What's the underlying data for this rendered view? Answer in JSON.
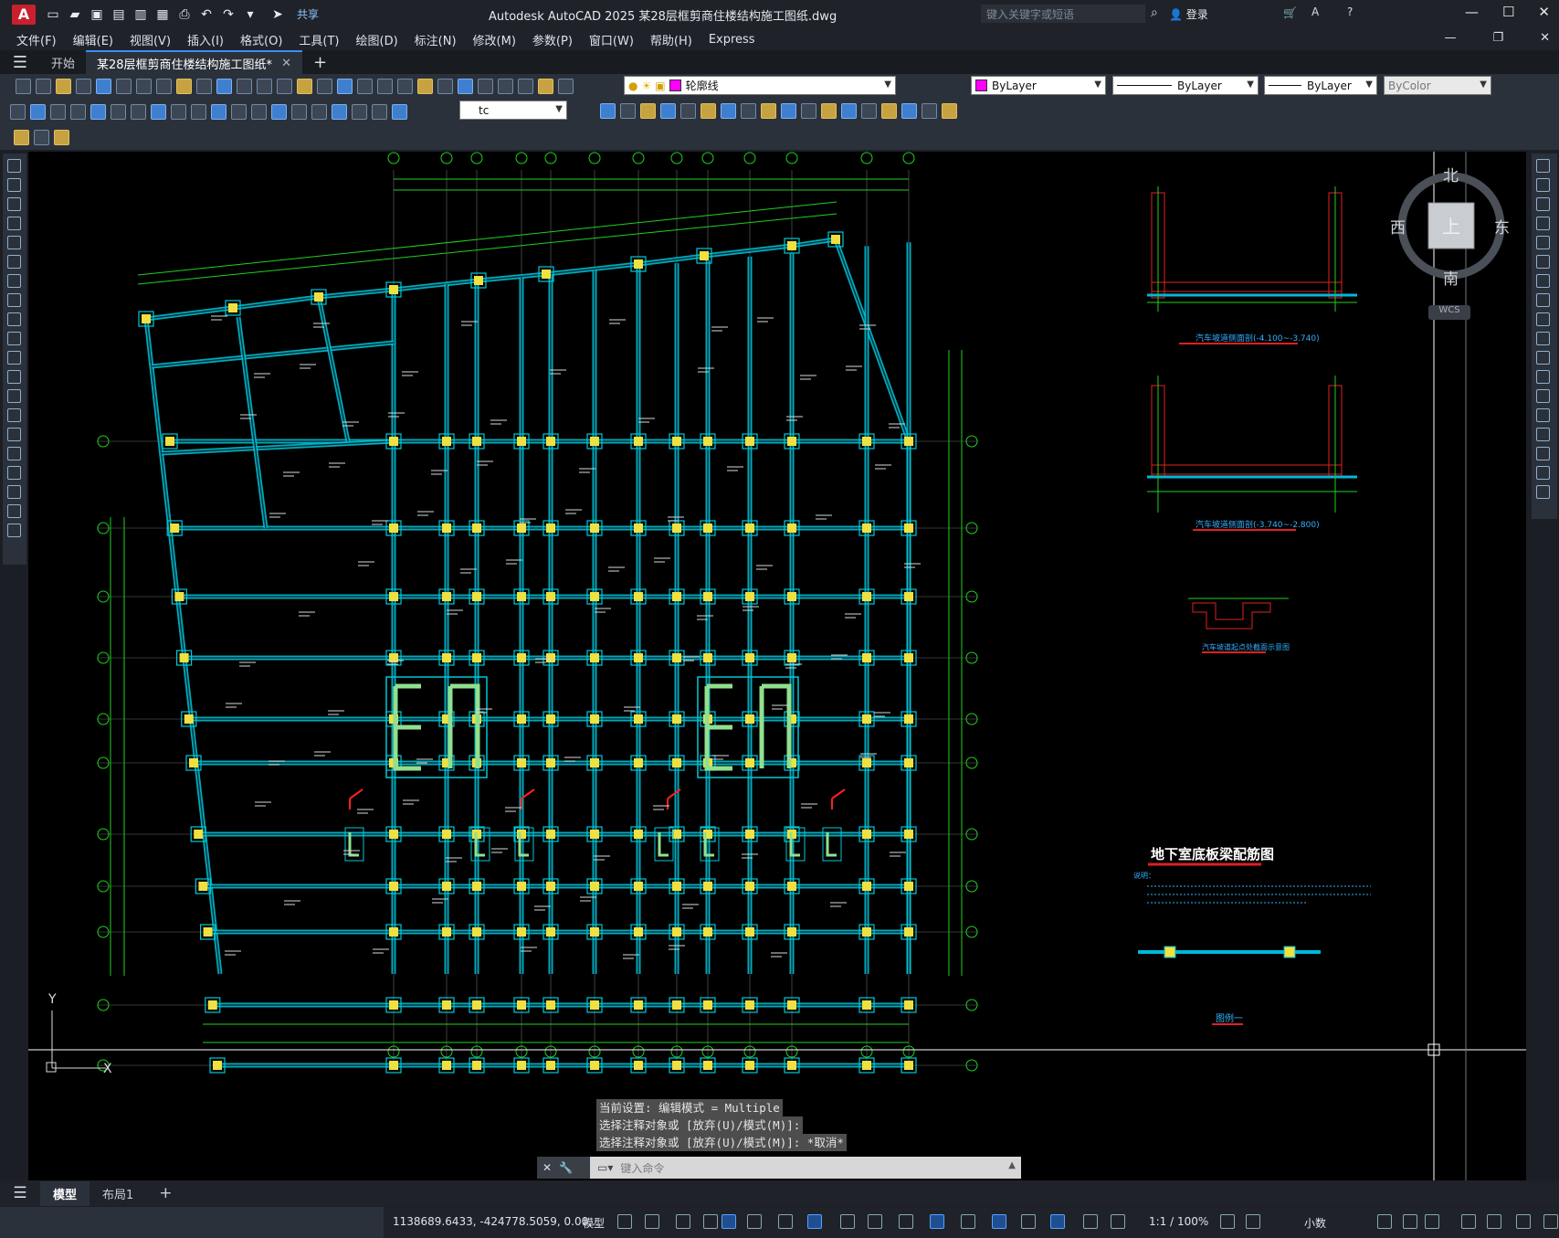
{
  "app": {
    "logo_letter": "A",
    "share_label": "共享",
    "window_title": "Autodesk AutoCAD 2025    某28层框剪商住楼结构施工图纸.dwg",
    "search_placeholder": "键入关键字或短语",
    "login_label": "登录"
  },
  "menu": {
    "items": [
      "文件(F)",
      "编辑(E)",
      "视图(V)",
      "插入(I)",
      "格式(O)",
      "工具(T)",
      "绘图(D)",
      "标注(N)",
      "修改(M)",
      "参数(P)",
      "窗口(W)",
      "帮助(H)",
      "Express"
    ]
  },
  "tabs": {
    "start": "开始",
    "active": "某28层框剪商住楼结构施工图纸*",
    "close": "✕",
    "new": "+"
  },
  "toolbar": {
    "layer_name": "轮廓线",
    "color_value": "ByLayer",
    "linetype_value": "ByLayer",
    "lineweight_value": "ByLayer",
    "plotstyle_value": "ByColor",
    "textstyle_value": "tc"
  },
  "viewcube": {
    "north": "北",
    "south": "南",
    "east": "东",
    "west": "西",
    "top": "上",
    "wcs": "WCS"
  },
  "drawing": {
    "main_title": "地下室底板梁配筋图",
    "section1_title": "汽车坡道侧面剖(-4.100~-3.740)",
    "section2_title": "汽车坡道侧面剖(-3.740~-2.800)",
    "section3_title": "汽车坡道起点处截面示意图",
    "legend_title": "图例一",
    "note_label": "说明：",
    "ucs_y": "Y",
    "ucs_x": "X"
  },
  "command": {
    "history": [
      "当前设置: 编辑模式 = Multiple",
      "选择注释对象或 [放弃(U)/模式(M)]:",
      "选择注释对象或 [放弃(U)/模式(M)]: *取消*"
    ],
    "placeholder": "键入命令"
  },
  "layout_tabs": {
    "model": "模型",
    "layout1": "布局1",
    "add": "+"
  },
  "status": {
    "coordinates": "1138689.6433, -424778.5059, 0.00...",
    "space": "模型",
    "annotation_scale": "1:1 / 100%",
    "units": "小数"
  }
}
